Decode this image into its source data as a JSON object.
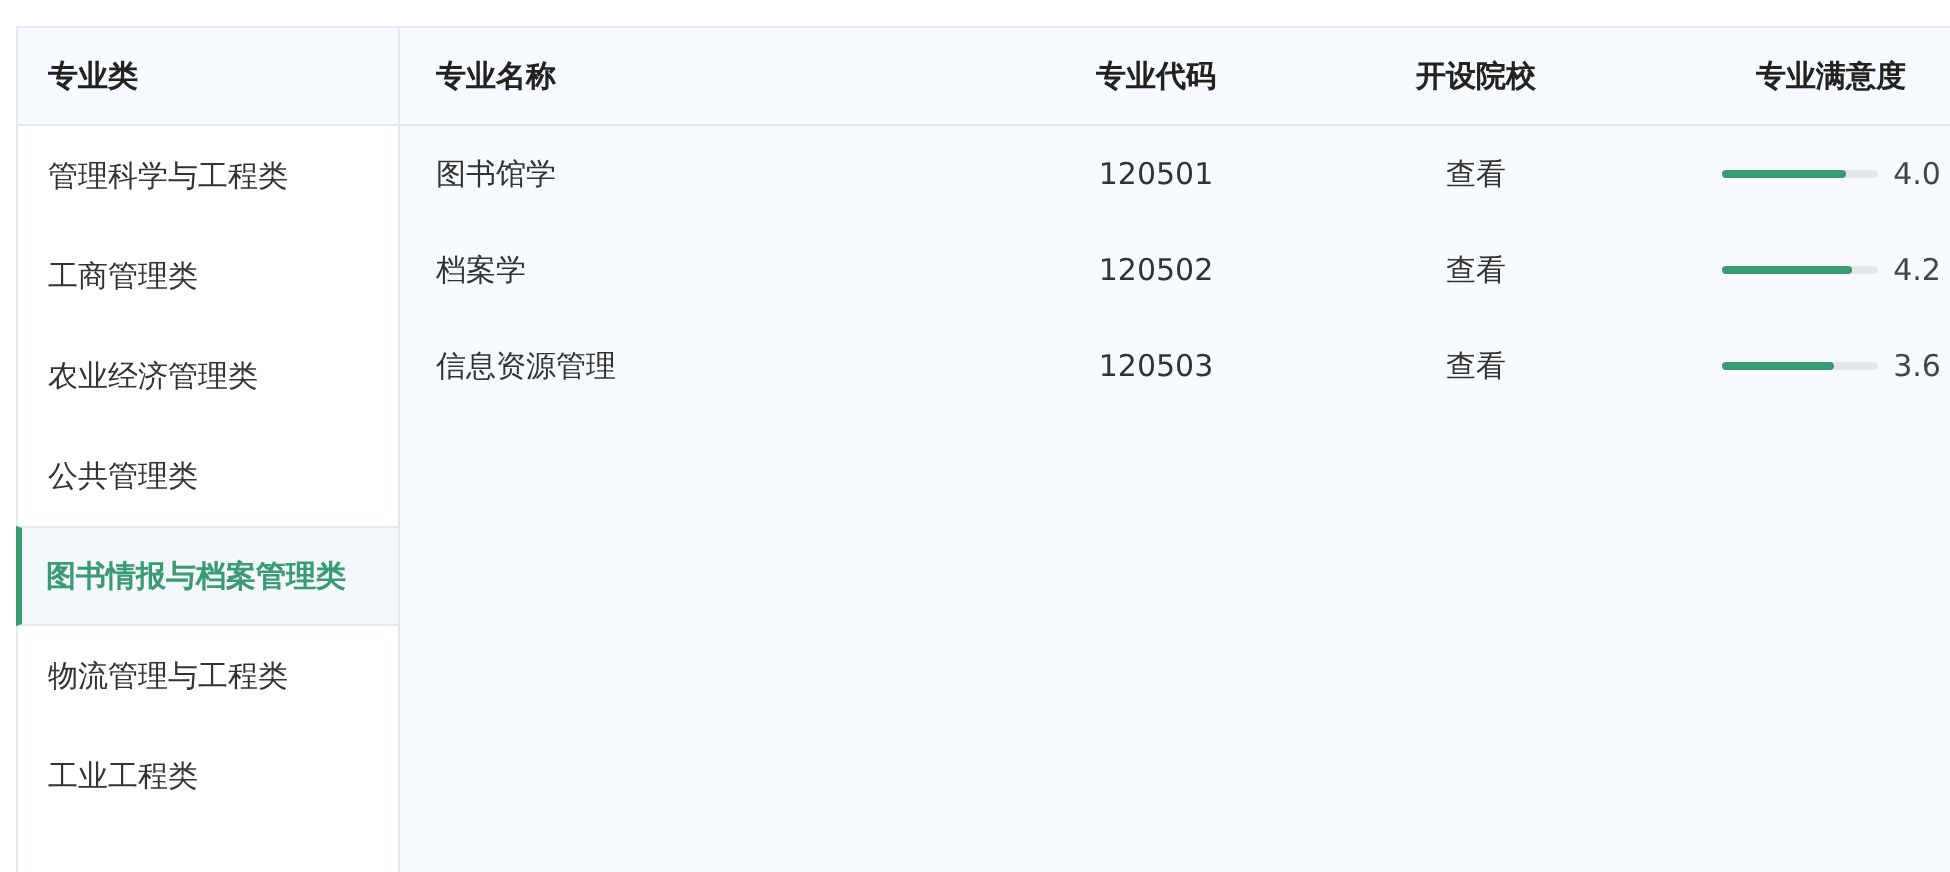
{
  "sidebar": {
    "header": "专业类",
    "items": [
      {
        "label": "管理科学与工程类",
        "selected": false
      },
      {
        "label": "工商管理类",
        "selected": false
      },
      {
        "label": "农业经济管理类",
        "selected": false
      },
      {
        "label": "公共管理类",
        "selected": false
      },
      {
        "label": "图书情报与档案管理类",
        "selected": true
      },
      {
        "label": "物流管理与工程类",
        "selected": false
      },
      {
        "label": "工业工程类",
        "selected": false
      }
    ]
  },
  "table": {
    "columns": [
      "专业名称",
      "专业代码",
      "开设院校",
      "专业满意度"
    ],
    "rows": [
      {
        "name": "图书馆学",
        "code": "120501",
        "schools": "查看",
        "level": 0.8,
        "rating": "4.0"
      },
      {
        "name": "档案学",
        "code": "120502",
        "schools": "查看",
        "level": 0.84,
        "rating": "4.2"
      },
      {
        "name": "信息资源管理",
        "code": "120503",
        "schools": "查看",
        "level": 0.72,
        "rating": "3.6"
      }
    ]
  }
}
